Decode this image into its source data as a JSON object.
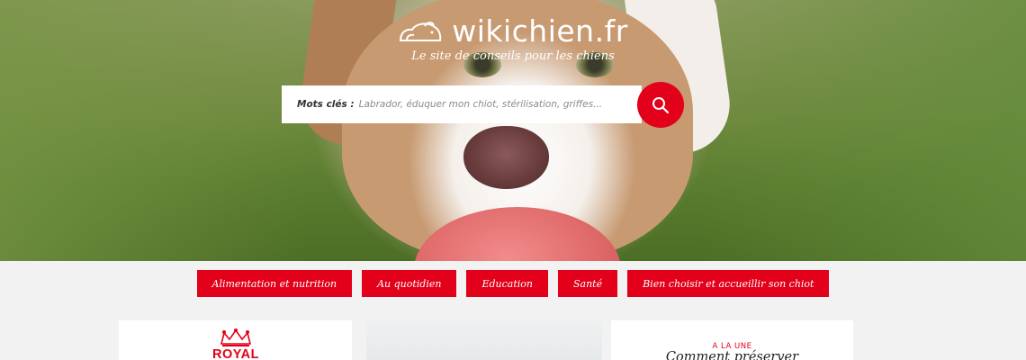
{
  "header": {
    "logo_text": "wikichien.fr",
    "tagline": "Le site de conseils pour les chiens"
  },
  "search": {
    "label": "Mots clés :",
    "placeholder": "Labrador, éduquer mon chiot, stérilisation, griffes...",
    "button_icon": "search-icon"
  },
  "nav": {
    "items": [
      {
        "label": "Alimentation et nutrition"
      },
      {
        "label": "Au quotidien"
      },
      {
        "label": "Education"
      },
      {
        "label": "Santé"
      },
      {
        "label": "Bien choisir et accueillir son chiot"
      }
    ]
  },
  "sponsor": {
    "brand_text": "ROYAL CANIN"
  },
  "featured": {
    "label": "A LA UNE",
    "title": "Comment préserver"
  },
  "colors": {
    "accent": "#e2001a",
    "background": "#f2f2f2"
  }
}
